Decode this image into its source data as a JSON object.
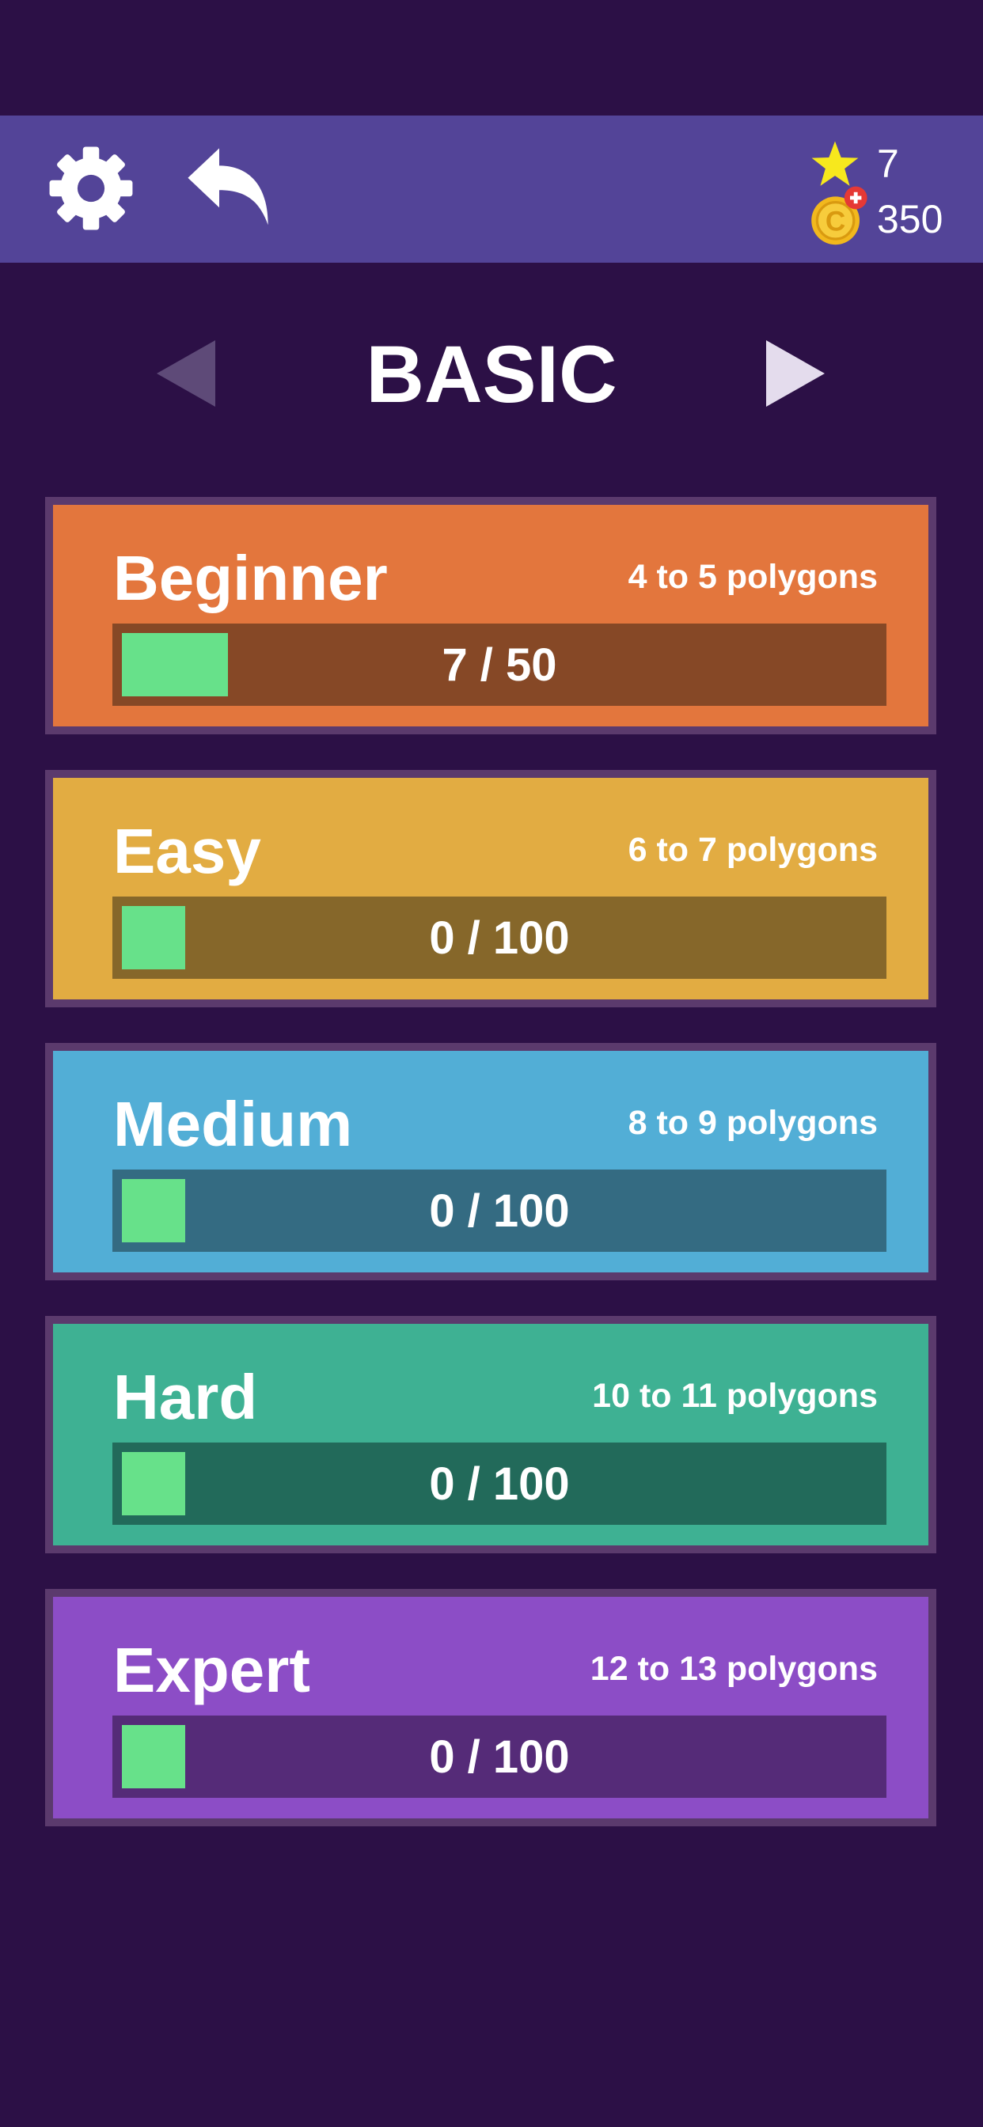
{
  "header": {
    "stars": "7",
    "coins": "350",
    "settings_icon": "gear-icon",
    "back_icon": "back-arrow-icon",
    "star_icon": "star-icon",
    "coin_icon": "coin-add-icon"
  },
  "world": {
    "title": "BASIC",
    "prev_icon": "triangle-left-icon",
    "next_icon": "triangle-right-icon"
  },
  "levels": [
    {
      "name": "Beginner",
      "range": "4 to 5 polygons",
      "progress": "7 / 50",
      "completed": 7,
      "total": 50,
      "color": "#e3763d",
      "bar_color": "#864826"
    },
    {
      "name": "Easy",
      "range": "6 to 7 polygons",
      "progress": "0 / 100",
      "completed": 0,
      "total": 100,
      "color": "#e2ac42",
      "bar_color": "#86672a"
    },
    {
      "name": "Medium",
      "range": "8 to 9 polygons",
      "progress": "0 / 100",
      "completed": 0,
      "total": 100,
      "color": "#52aed6",
      "bar_color": "#346b82"
    },
    {
      "name": "Hard",
      "range": "10 to 11 polygons",
      "progress": "0 / 100",
      "completed": 0,
      "total": 100,
      "color": "#3eb193",
      "bar_color": "#226a5a"
    },
    {
      "name": "Expert",
      "range": "12 to 13 polygons",
      "progress": "0 / 100",
      "completed": 0,
      "total": 100,
      "color": "#8c4dc6",
      "bar_color": "#552b78"
    }
  ],
  "colors": {
    "background": "#2c1046",
    "topbar": "#534498",
    "progress_fill": "#67e18a",
    "star": "#f7e81d",
    "coin": "#f2b81d"
  }
}
